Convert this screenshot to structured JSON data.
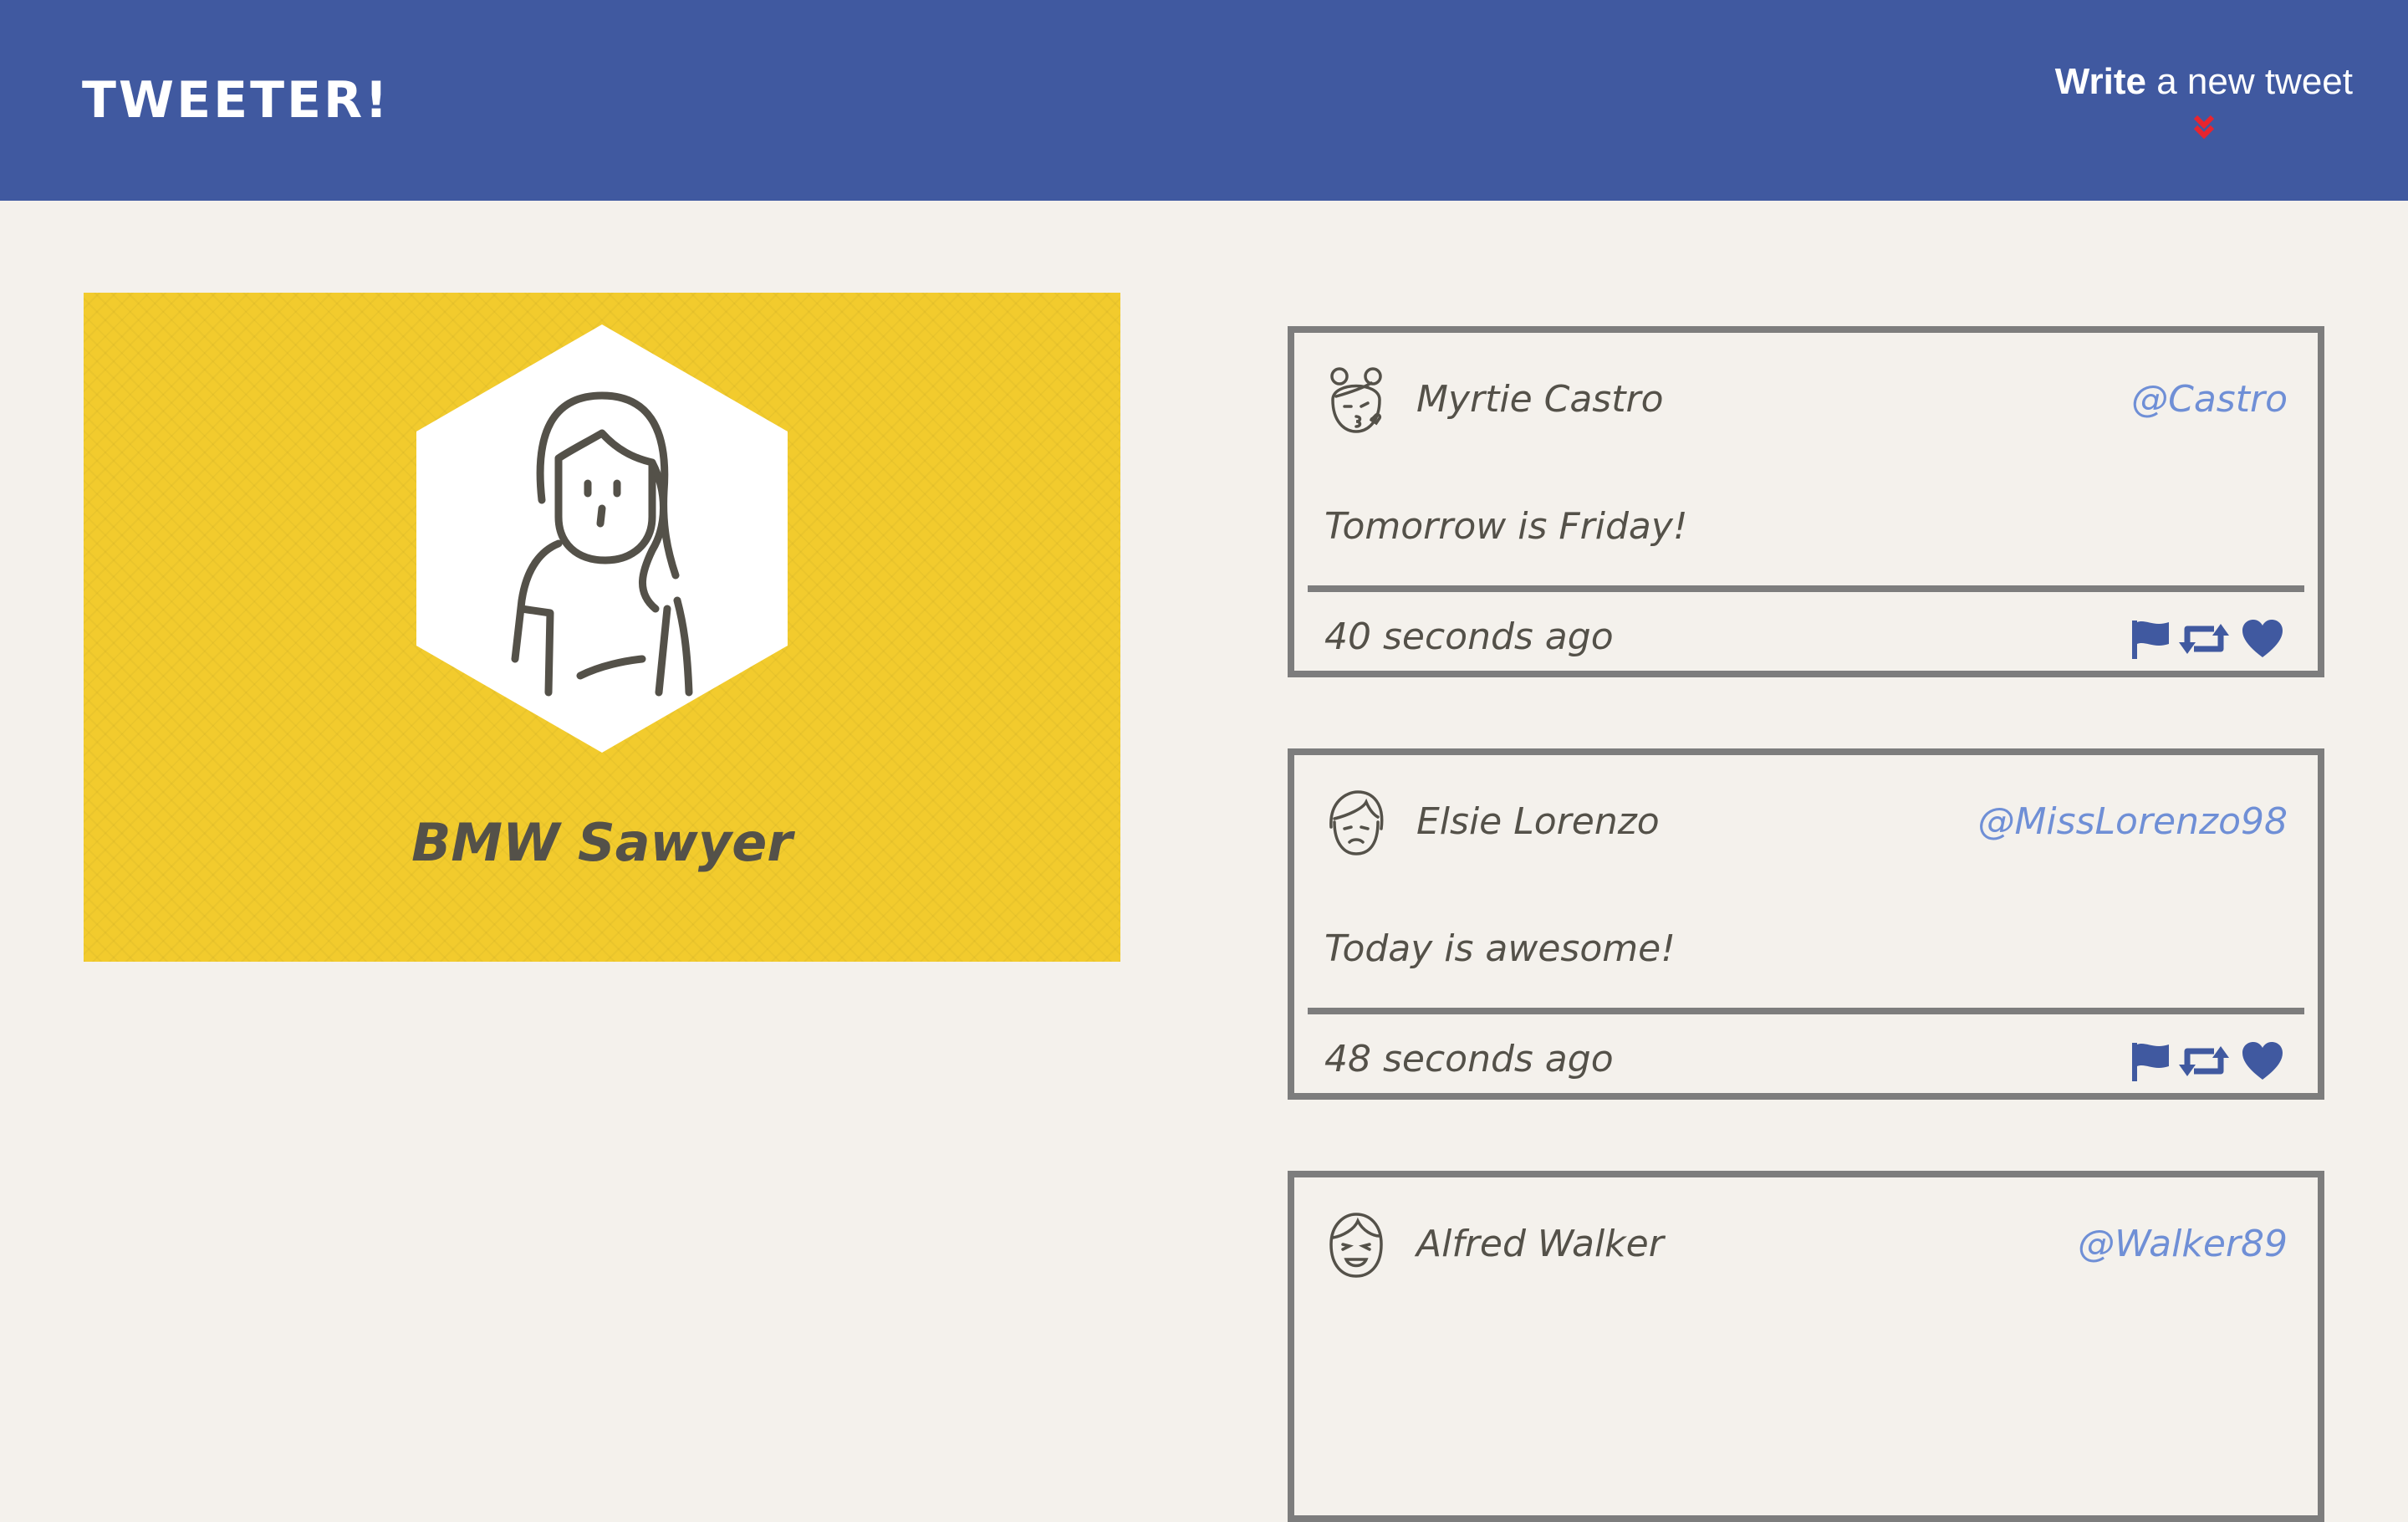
{
  "header": {
    "brand": "TWEETER!",
    "compose_bold": "Write",
    "compose_rest": " a new tweet",
    "compose_icon": "chevron-double-down-icon",
    "compose_icon_color": "#e8252f",
    "bar_color": "#4059a0"
  },
  "profile": {
    "name": "BMW Sawyer",
    "avatar_icon": "woman-avatar-icon",
    "background_color": "#f2cb2d"
  },
  "tweets": [
    {
      "name": "Myrtie Castro",
      "handle": "@Castro",
      "text": "Tomorrow is Friday!",
      "time": "40 seconds ago",
      "avatar_icon": "girl-kiss-avatar-icon"
    },
    {
      "name": "Elsie Lorenzo",
      "handle": "@MissLorenzo98",
      "text": "Today is awesome!",
      "time": "48 seconds ago",
      "avatar_icon": "woman-frown-avatar-icon"
    },
    {
      "name": "Alfred Walker",
      "handle": "@Walker89",
      "text": "",
      "time": "",
      "avatar_icon": "man-laugh-avatar-icon"
    }
  ],
  "actions": {
    "flag_icon": "flag-icon",
    "retweet_icon": "retweet-icon",
    "like_icon": "heart-icon",
    "icon_color": "#4059a0"
  },
  "colors": {
    "page_bg": "#f4f1ec",
    "handle": "#6f8fd6",
    "border": "#7d7d7d"
  }
}
